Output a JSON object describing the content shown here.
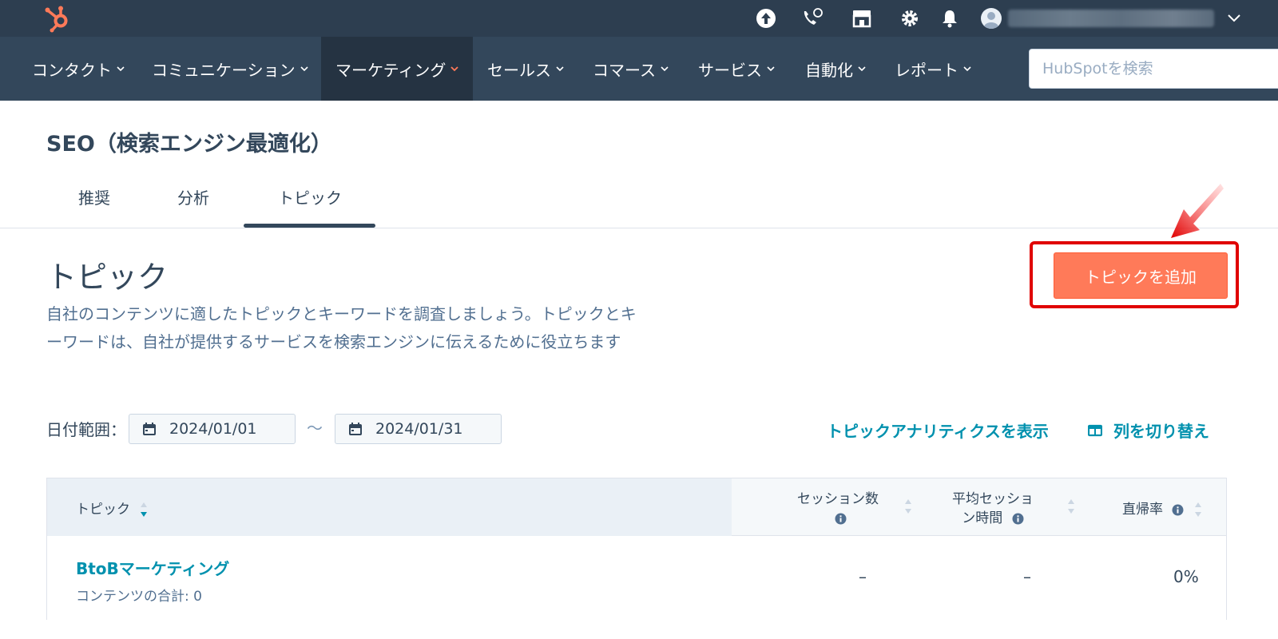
{
  "topbar": {
    "logo_icon": "hubspot-sprocket-icon",
    "icons": [
      "upgrade-arrow-icon",
      "calling-icon",
      "marketplace-icon",
      "settings-gear-icon",
      "notifications-bell-icon"
    ],
    "account_chevron_icon": "chevron-down-icon"
  },
  "nav": {
    "items": [
      {
        "label": "コンタクト"
      },
      {
        "label": "コミュニケーション"
      },
      {
        "label": "マーケティング",
        "active": true
      },
      {
        "label": "セールス"
      },
      {
        "label": "コマース"
      },
      {
        "label": "サービス"
      },
      {
        "label": "自動化"
      },
      {
        "label": "レポート"
      }
    ],
    "search_placeholder": "HubSpotを検索"
  },
  "page": {
    "title": "SEO（検索エンジン最適化）",
    "tabs": [
      {
        "label": "推奨"
      },
      {
        "label": "分析"
      },
      {
        "label": "トピック",
        "selected": true
      }
    ]
  },
  "section": {
    "title": "トピック",
    "description": "自社のコンテンツに適したトピックとキーワードを調査しましょう。トピックとキーワードは、自社が提供するサービスを検索エンジンに伝えるために役立ちます",
    "add_button": "トピックを追加"
  },
  "filters": {
    "date_label": "日付範囲：",
    "start_date": "2024/01/01",
    "separator": "～",
    "end_date": "2024/01/31",
    "analytics_link": "トピックアナリティクスを表示",
    "columns_link": "列を切り替え"
  },
  "table": {
    "headers": {
      "topic": "トピック",
      "sessions_line1": "セッション数",
      "avg_line1": "平均セッショ",
      "avg_line2": "ン時間",
      "bounce": "直帰率"
    },
    "rows": [
      {
        "name": "BtoBマーケティング",
        "sub": "コンテンツの合計: 0",
        "sessions": "–",
        "avg_time": "–",
        "bounce": "0%"
      }
    ]
  },
  "colors": {
    "topbar": "#2d3e50",
    "navbar": "#33475b",
    "accent_orange": "#ff7a59",
    "link_teal": "#0091ae",
    "highlight_red": "#e00000"
  }
}
